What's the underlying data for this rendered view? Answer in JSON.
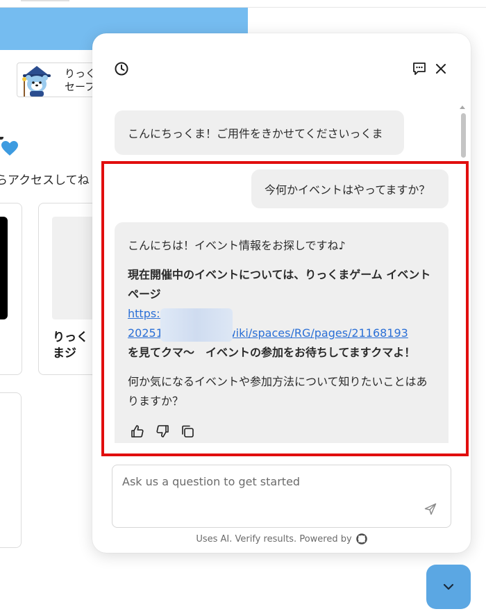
{
  "background": {
    "profile_line1": "りっく",
    "profile_line2": "セーフ",
    "access_text": "らアクセスしてね",
    "card_title": "りっくまジ",
    "colors": {
      "banner": "#75bcf0",
      "heart": "#3d9be0"
    }
  },
  "chat": {
    "header": {
      "history_icon": "clock-icon",
      "new_chat_icon": "new-chat-icon",
      "close_icon": "close-icon"
    },
    "messages": {
      "greeting": "こんにちっくま！ご用件をきかせてくださいっくま",
      "user": "今何かイベントはやってますか？",
      "bot": {
        "p1": "こんにちは！イベント情報をお探しですね♪",
        "p2_bold": "現在開催中のイベントについては、りっくまゲーム イベントページ",
        "link_line1": "https:/",
        "link_line2_start": "20251(",
        "link_line2_end": "/wiki/spaces/RG/pages/21168193",
        "p2_after": "を見てクマ〜　イベントの参加をお待ちしてますクマよ！",
        "p3": "何か気になるイベントや参加方法について知りたいことはありますか？"
      }
    },
    "feedback": {
      "like_icon": "thumbs-up-icon",
      "dislike_icon": "thumbs-down-icon",
      "copy_icon": "copy-icon"
    },
    "input": {
      "placeholder": "Ask us a question to get started",
      "send_icon": "send-icon"
    },
    "footer": "Uses AI. Verify results. Powered by"
  },
  "fab": {
    "icon": "chevron-down-icon",
    "color": "#5ba7e3"
  },
  "highlight_color": "#e10e0e"
}
